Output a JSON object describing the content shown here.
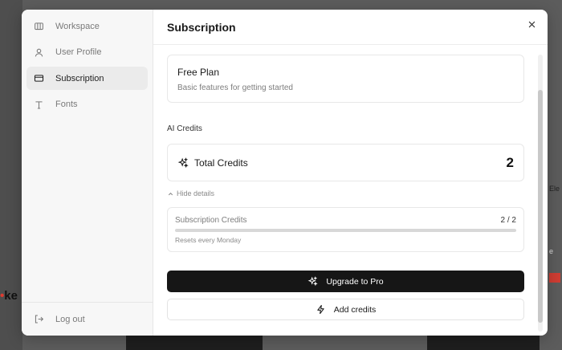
{
  "background": {
    "left_brand_text": "ke",
    "right_text_1": "Ele",
    "right_text_2": "e"
  },
  "sidebar": {
    "items": [
      {
        "label": "Workspace",
        "icon": "building-icon",
        "active": false
      },
      {
        "label": "User Profile",
        "icon": "user-icon",
        "active": false
      },
      {
        "label": "Subscription",
        "icon": "credit-card-icon",
        "active": true
      },
      {
        "label": "Fonts",
        "icon": "type-icon",
        "active": false
      }
    ],
    "logout_label": "Log out"
  },
  "header": {
    "title": "Subscription"
  },
  "plan": {
    "name": "Free Plan",
    "description": "Basic features for getting started"
  },
  "credits": {
    "section_label": "AI Credits",
    "total_label": "Total Credits",
    "total_value": "2",
    "toggle_label": "Hide details",
    "subscription_label": "Subscription Credits",
    "subscription_value": "2 / 2",
    "progress_fraction": 1.0,
    "reset_note": "Resets every Monday"
  },
  "actions": {
    "upgrade_label": "Upgrade to Pro",
    "add_credits_label": "Add credits"
  },
  "colors": {
    "primary_button": "#161616",
    "active_nav": "#ebebeb"
  }
}
